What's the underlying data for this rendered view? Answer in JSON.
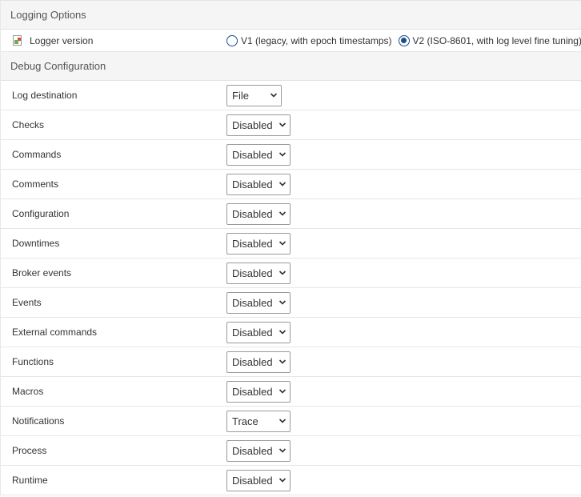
{
  "logging_options": {
    "header": "Logging Options",
    "logger_version": {
      "label": "Logger version",
      "options": [
        {
          "label": "V1 (legacy, with epoch timestamps)",
          "checked": false
        },
        {
          "label": "V2 (ISO-8601, with log level fine tuning)",
          "checked": true
        }
      ]
    }
  },
  "debug_configuration": {
    "header": "Debug Configuration",
    "rows": [
      {
        "label": "Log destination",
        "value": "File"
      },
      {
        "label": "Checks",
        "value": "Disabled"
      },
      {
        "label": "Commands",
        "value": "Disabled"
      },
      {
        "label": "Comments",
        "value": "Disabled"
      },
      {
        "label": "Configuration",
        "value": "Disabled"
      },
      {
        "label": "Downtimes",
        "value": "Disabled"
      },
      {
        "label": "Broker events",
        "value": "Disabled"
      },
      {
        "label": "Events",
        "value": "Disabled"
      },
      {
        "label": "External commands",
        "value": "Disabled"
      },
      {
        "label": "Functions",
        "value": "Disabled"
      },
      {
        "label": "Macros",
        "value": "Disabled"
      },
      {
        "label": "Notifications",
        "value": "Trace"
      },
      {
        "label": "Process",
        "value": "Disabled"
      },
      {
        "label": "Runtime",
        "value": "Disabled"
      }
    ]
  },
  "colors": {
    "radio_accent": "#1a4f8a",
    "header_bg": "#f5f5f5"
  }
}
